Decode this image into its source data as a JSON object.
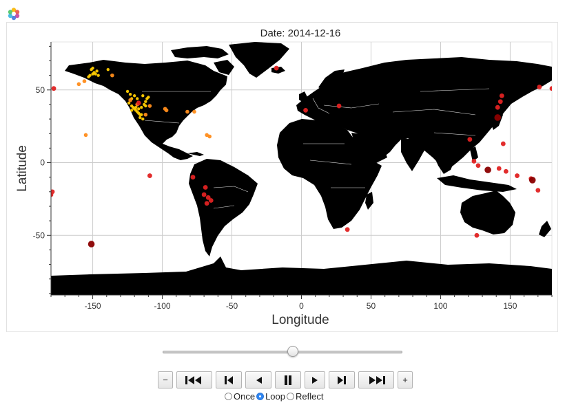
{
  "app": {
    "logo_icon": "bokeh-logo-icon"
  },
  "chart_data": {
    "type": "scatter",
    "title": "Date: 2014-12-16",
    "xlabel": "Longitude",
    "ylabel": "Latitude",
    "xlim": [
      -180,
      180
    ],
    "ylim": [
      -91,
      83
    ],
    "xticks": [
      -150,
      -100,
      -50,
      0,
      50,
      100,
      150
    ],
    "yticks": [
      -50,
      0,
      50
    ],
    "grid": true,
    "background": "world map (country outlines, black fill, white borders)",
    "colors": {
      "land": "#000000",
      "borders": "#ffffff",
      "grid": "#cccccc"
    },
    "points": [
      {
        "lon": -178,
        "lat": 51,
        "color": "#e02222"
      },
      {
        "lon": -179,
        "lat": -20,
        "color": "#e02222"
      },
      {
        "lon": -180,
        "lat": -22,
        "color": "#e02222"
      },
      {
        "lon": -151,
        "lat": -56,
        "color": "#8b0000"
      },
      {
        "lon": -109,
        "lat": -9,
        "color": "#e02222"
      },
      {
        "lon": -155,
        "lat": 19,
        "color": "#ff8c1a"
      },
      {
        "lon": -66,
        "lat": 18,
        "color": "#ff8c1a"
      },
      {
        "lon": -68,
        "lat": 19,
        "color": "#ff8c1a"
      },
      {
        "lon": -150,
        "lat": 61,
        "color": "#ffcc00"
      },
      {
        "lon": -149,
        "lat": 62,
        "color": "#ffcc00"
      },
      {
        "lon": -152,
        "lat": 60,
        "color": "#ffcc00"
      },
      {
        "lon": -151,
        "lat": 64,
        "color": "#ffcc00"
      },
      {
        "lon": -147,
        "lat": 63,
        "color": "#ffcc00"
      },
      {
        "lon": -148,
        "lat": 61,
        "color": "#ffcc00"
      },
      {
        "lon": -153,
        "lat": 59,
        "color": "#ffcc00"
      },
      {
        "lon": -150,
        "lat": 65,
        "color": "#ffcc00"
      },
      {
        "lon": -146,
        "lat": 60,
        "color": "#ffcc00"
      },
      {
        "lon": -139,
        "lat": 64,
        "color": "#ffcc00"
      },
      {
        "lon": -156,
        "lat": 56,
        "color": "#ff8c1a"
      },
      {
        "lon": -160,
        "lat": 54,
        "color": "#ff8c1a"
      },
      {
        "lon": -136,
        "lat": 60,
        "color": "#ff8c1a"
      },
      {
        "lon": -125,
        "lat": 49,
        "color": "#ffcc00"
      },
      {
        "lon": -123,
        "lat": 47,
        "color": "#ffcc00"
      },
      {
        "lon": -122,
        "lat": 44,
        "color": "#ffcc00"
      },
      {
        "lon": -120,
        "lat": 46,
        "color": "#ffcc00"
      },
      {
        "lon": -118,
        "lat": 44,
        "color": "#ffcc00"
      },
      {
        "lon": -124,
        "lat": 41,
        "color": "#ffcc00"
      },
      {
        "lon": -122,
        "lat": 39,
        "color": "#ffcc00"
      },
      {
        "lon": -121,
        "lat": 38,
        "color": "#ffcc00"
      },
      {
        "lon": -120,
        "lat": 37,
        "color": "#ffcc00"
      },
      {
        "lon": -119,
        "lat": 36,
        "color": "#ffcc00"
      },
      {
        "lon": -118,
        "lat": 35,
        "color": "#ffcc00"
      },
      {
        "lon": -117,
        "lat": 34,
        "color": "#ffcc00"
      },
      {
        "lon": -116,
        "lat": 33,
        "color": "#ffcc00"
      },
      {
        "lon": -115,
        "lat": 33,
        "color": "#ffcc00"
      },
      {
        "lon": -119,
        "lat": 38,
        "color": "#ffcc00"
      },
      {
        "lon": -117,
        "lat": 37,
        "color": "#ffcc00"
      },
      {
        "lon": -115,
        "lat": 38,
        "color": "#ffcc00"
      },
      {
        "lon": -113,
        "lat": 40,
        "color": "#ffcc00"
      },
      {
        "lon": -112,
        "lat": 42,
        "color": "#ffcc00"
      },
      {
        "lon": -111,
        "lat": 44,
        "color": "#ffcc00"
      },
      {
        "lon": -110,
        "lat": 45,
        "color": "#ffcc00"
      },
      {
        "lon": -114,
        "lat": 46,
        "color": "#ffcc00"
      },
      {
        "lon": -122,
        "lat": 36,
        "color": "#ffcc00"
      },
      {
        "lon": -116,
        "lat": 31,
        "color": "#ffcc00"
      },
      {
        "lon": -114,
        "lat": 30,
        "color": "#ffcc00"
      },
      {
        "lon": -109,
        "lat": 39,
        "color": "#ff8c1a"
      },
      {
        "lon": -118,
        "lat": 40,
        "color": "#ff8c1a"
      },
      {
        "lon": -123,
        "lat": 43,
        "color": "#ff8c1a"
      },
      {
        "lon": -97,
        "lat": 36,
        "color": "#ff8c1a"
      },
      {
        "lon": -98,
        "lat": 37,
        "color": "#ff8c1a"
      },
      {
        "lon": -82,
        "lat": 35,
        "color": "#ff8c1a"
      },
      {
        "lon": -77,
        "lat": 35,
        "color": "#ff8c1a"
      },
      {
        "lon": -112,
        "lat": 33,
        "color": "#ff8c1a"
      },
      {
        "lon": -117,
        "lat": 41,
        "color": "#e02222"
      },
      {
        "lon": -112,
        "lat": 39,
        "color": "#ffcc00"
      },
      {
        "lon": -78,
        "lat": -10,
        "color": "#e02222"
      },
      {
        "lon": -69,
        "lat": -17,
        "color": "#e02222"
      },
      {
        "lon": -70,
        "lat": -22,
        "color": "#e02222"
      },
      {
        "lon": -67,
        "lat": -24,
        "color": "#e02222"
      },
      {
        "lon": -68,
        "lat": -28,
        "color": "#e02222"
      },
      {
        "lon": -65,
        "lat": -26,
        "color": "#e02222"
      },
      {
        "lon": -18,
        "lat": 65,
        "color": "#e02222"
      },
      {
        "lon": 3,
        "lat": 36,
        "color": "#e02222"
      },
      {
        "lon": 27,
        "lat": 39,
        "color": "#e02222"
      },
      {
        "lon": 33,
        "lat": -46,
        "color": "#e02222"
      },
      {
        "lon": 121,
        "lat": 16,
        "color": "#e02222"
      },
      {
        "lon": 124,
        "lat": 1,
        "color": "#e02222"
      },
      {
        "lon": 127,
        "lat": -2,
        "color": "#e02222"
      },
      {
        "lon": 134,
        "lat": -5,
        "color": "#8b0000"
      },
      {
        "lon": 142,
        "lat": -4,
        "color": "#e02222"
      },
      {
        "lon": 147,
        "lat": -6,
        "color": "#e02222"
      },
      {
        "lon": 141,
        "lat": 31,
        "color": "#8b0000"
      },
      {
        "lon": 141,
        "lat": 38,
        "color": "#e02222"
      },
      {
        "lon": 143,
        "lat": 42,
        "color": "#e02222"
      },
      {
        "lon": 144,
        "lat": 46,
        "color": "#e02222"
      },
      {
        "lon": 145,
        "lat": 13,
        "color": "#e02222"
      },
      {
        "lon": 126,
        "lat": -50,
        "color": "#e02222"
      },
      {
        "lon": 155,
        "lat": -9,
        "color": "#e02222"
      },
      {
        "lon": 165,
        "lat": -11,
        "color": "#e02222"
      },
      {
        "lon": 166,
        "lat": -12,
        "color": "#8b0000"
      },
      {
        "lon": 170,
        "lat": -19,
        "color": "#e02222"
      },
      {
        "lon": 171,
        "lat": 52,
        "color": "#e02222"
      },
      {
        "lon": 180,
        "lat": 51,
        "color": "#e02222"
      }
    ]
  },
  "player": {
    "slider_fraction": 0.546,
    "buttons": {
      "minus_label": "−",
      "plus_label": "+",
      "first_icon": "skip-to-first-icon",
      "prev_icon": "step-back-icon",
      "reverse_icon": "play-reverse-icon",
      "pause_icon": "pause-icon",
      "play_icon": "play-icon",
      "next_icon": "step-forward-icon",
      "last_icon": "skip-to-last-icon"
    },
    "modes": [
      {
        "label": "Once",
        "selected": false
      },
      {
        "label": "Loop",
        "selected": true
      },
      {
        "label": "Reflect",
        "selected": false
      }
    ]
  }
}
